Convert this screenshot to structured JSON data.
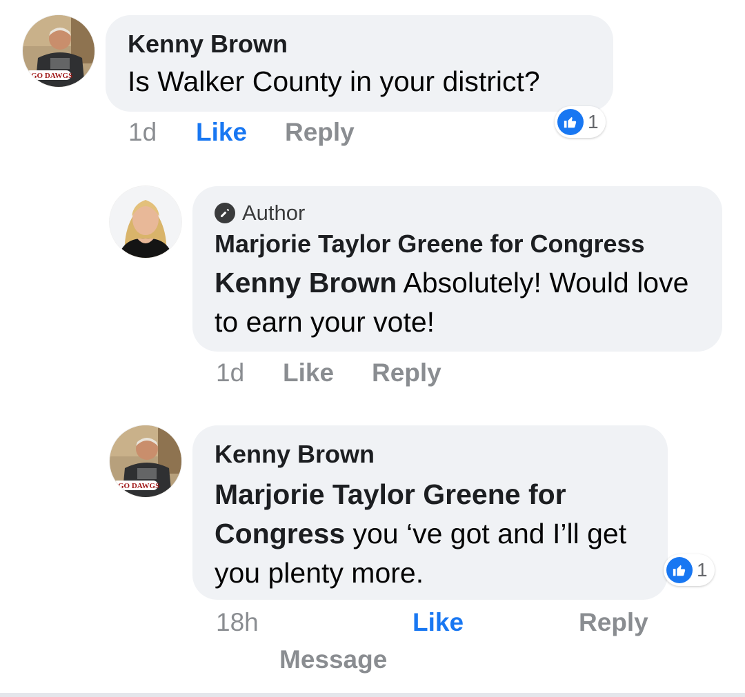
{
  "comments": [
    {
      "author": "Kenny Brown",
      "avatar_icon": "user-photo-icon",
      "avatar_caption": "GO DAWGS",
      "mention": "",
      "text": "Is Walker County in your district?",
      "time": "1d",
      "like_label": "Like",
      "reply_label": "Reply",
      "reaction_count": "1",
      "liked": true
    },
    {
      "badge": "Author",
      "badge_icon": "pencil-icon",
      "author": "Marjorie Taylor Greene for Congress",
      "avatar_icon": "user-photo-icon",
      "mention": "Kenny Brown",
      "text": " Absolutely! Would love to earn your vote!",
      "time": "1d",
      "like_label": "Like",
      "reply_label": "Reply",
      "liked": false
    },
    {
      "author": "Kenny Brown",
      "avatar_icon": "user-photo-icon",
      "avatar_caption": "GO DAWGS",
      "mention": "Marjorie Taylor Greene for Congress",
      "text": " you ‘ve got and I’ll get you plenty more.",
      "time": "18h",
      "like_label": "Like",
      "reply_label": "Reply",
      "message_label": "Message",
      "reaction_count": "1",
      "liked": true
    }
  ],
  "colors": {
    "bubble": "#f0f2f5",
    "like_active": "#1877f2",
    "meta": "#8a8d91"
  }
}
